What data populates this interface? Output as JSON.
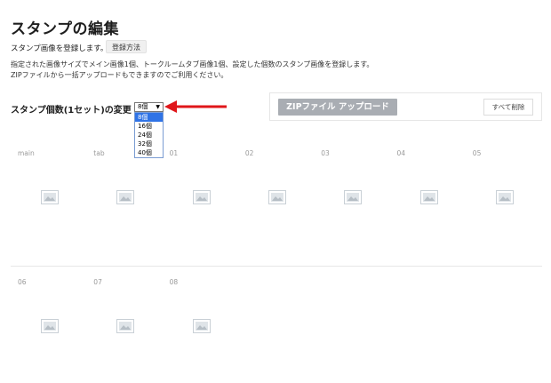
{
  "header": {
    "title": "スタンプの編集",
    "subtitle": "スタンプ画像を登録します。",
    "help_button": "登録方法",
    "description_line1": "指定された画像サイズでメイン画像1個、トークルームタブ画像1個、設定した個数のスタンプ画像を登録します。",
    "description_line2": "ZIPファイルから一括アップロードもできますのでご利用ください。"
  },
  "count_selector": {
    "label": "スタンプ個数(1セット)の変更",
    "selected": "8個",
    "arrow_glyph": "▼",
    "options": [
      "8個",
      "16個",
      "24個",
      "32個",
      "40個"
    ]
  },
  "upload": {
    "zip_button": "ZIPファイル アップロード",
    "delete_all_button": "すべて削除"
  },
  "annotation": {
    "arrow_color": "#e0161a"
  },
  "slots": [
    "main",
    "tab",
    "01",
    "02",
    "03",
    "04",
    "05",
    "06",
    "07",
    "08"
  ],
  "icons": {
    "placeholder": "image-placeholder-icon"
  }
}
